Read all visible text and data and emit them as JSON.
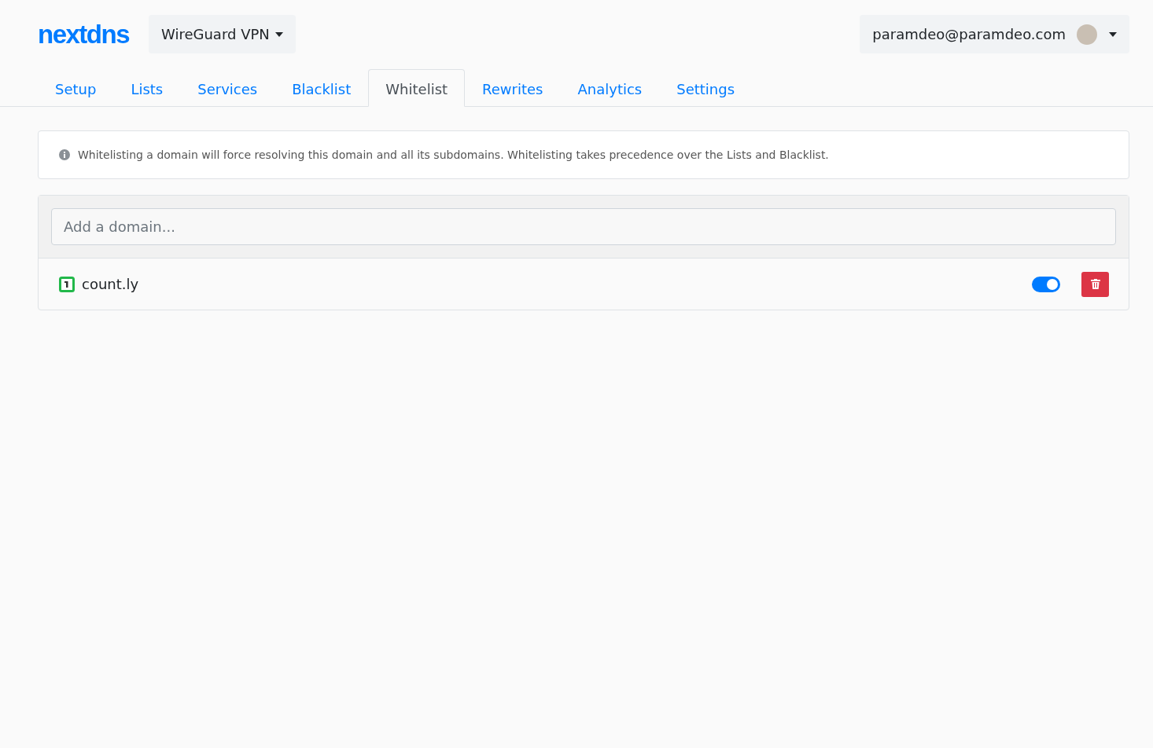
{
  "header": {
    "logo": "nextdns",
    "profile": "WireGuard VPN",
    "account": "paramdeo@paramdeo.com"
  },
  "tabs": [
    {
      "label": "Setup",
      "selected": false
    },
    {
      "label": "Lists",
      "selected": false
    },
    {
      "label": "Services",
      "selected": false
    },
    {
      "label": "Blacklist",
      "selected": false
    },
    {
      "label": "Whitelist",
      "selected": true
    },
    {
      "label": "Rewrites",
      "selected": false
    },
    {
      "label": "Analytics",
      "selected": false
    },
    {
      "label": "Settings",
      "selected": false
    }
  ],
  "info": "Whitelisting a domain will force resolving this domain and all its subdomains. Whitelisting takes precedence over the Lists and Blacklist.",
  "search": {
    "placeholder": "Add a domain..."
  },
  "domains": [
    {
      "name": "count.ly",
      "on": true
    }
  ]
}
